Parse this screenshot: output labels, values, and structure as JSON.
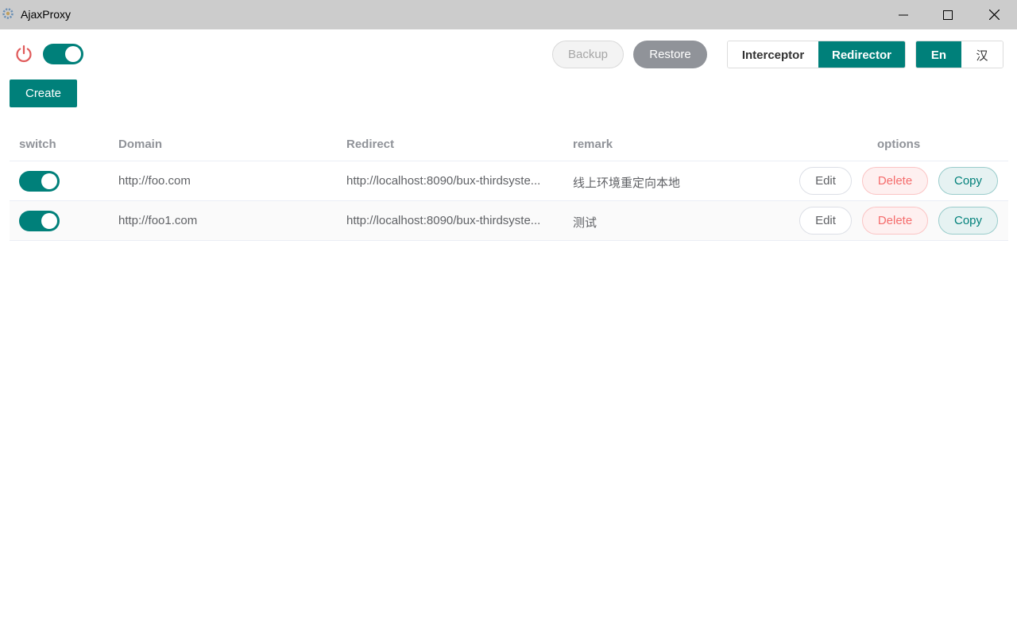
{
  "window": {
    "title": "AjaxProxy",
    "icons": {
      "app": "gear-icon",
      "minimize": "minimize-icon",
      "maximize": "maximize-icon",
      "close": "close-icon"
    }
  },
  "toolbar": {
    "power_icon": "power-icon",
    "master_switch_on": true,
    "backup_label": "Backup",
    "restore_label": "Restore",
    "mode_tabs": [
      {
        "label": "Interceptor",
        "active": false
      },
      {
        "label": "Redirector",
        "active": true
      }
    ],
    "language_tabs": [
      {
        "label": "En",
        "active": true
      },
      {
        "label": "汉",
        "active": false
      }
    ],
    "create_label": "Create"
  },
  "table": {
    "columns": [
      "switch",
      "Domain",
      "Redirect",
      "remark",
      "options"
    ],
    "rows": [
      {
        "enabled": true,
        "domain": "http://foo.com",
        "redirect": "http://localhost:8090/bux-thirdsyste...",
        "remark": "线上环境重定向本地"
      },
      {
        "enabled": true,
        "domain": "http://foo1.com",
        "redirect": "http://localhost:8090/bux-thirdsyste...",
        "remark": "测试"
      }
    ],
    "option_labels": {
      "edit": "Edit",
      "delete": "Delete",
      "copy": "Copy"
    }
  },
  "colors": {
    "accent": "#00807a",
    "titlebar": "#cccccc",
    "danger": "#f56c6c",
    "power": "#e05a5a"
  }
}
